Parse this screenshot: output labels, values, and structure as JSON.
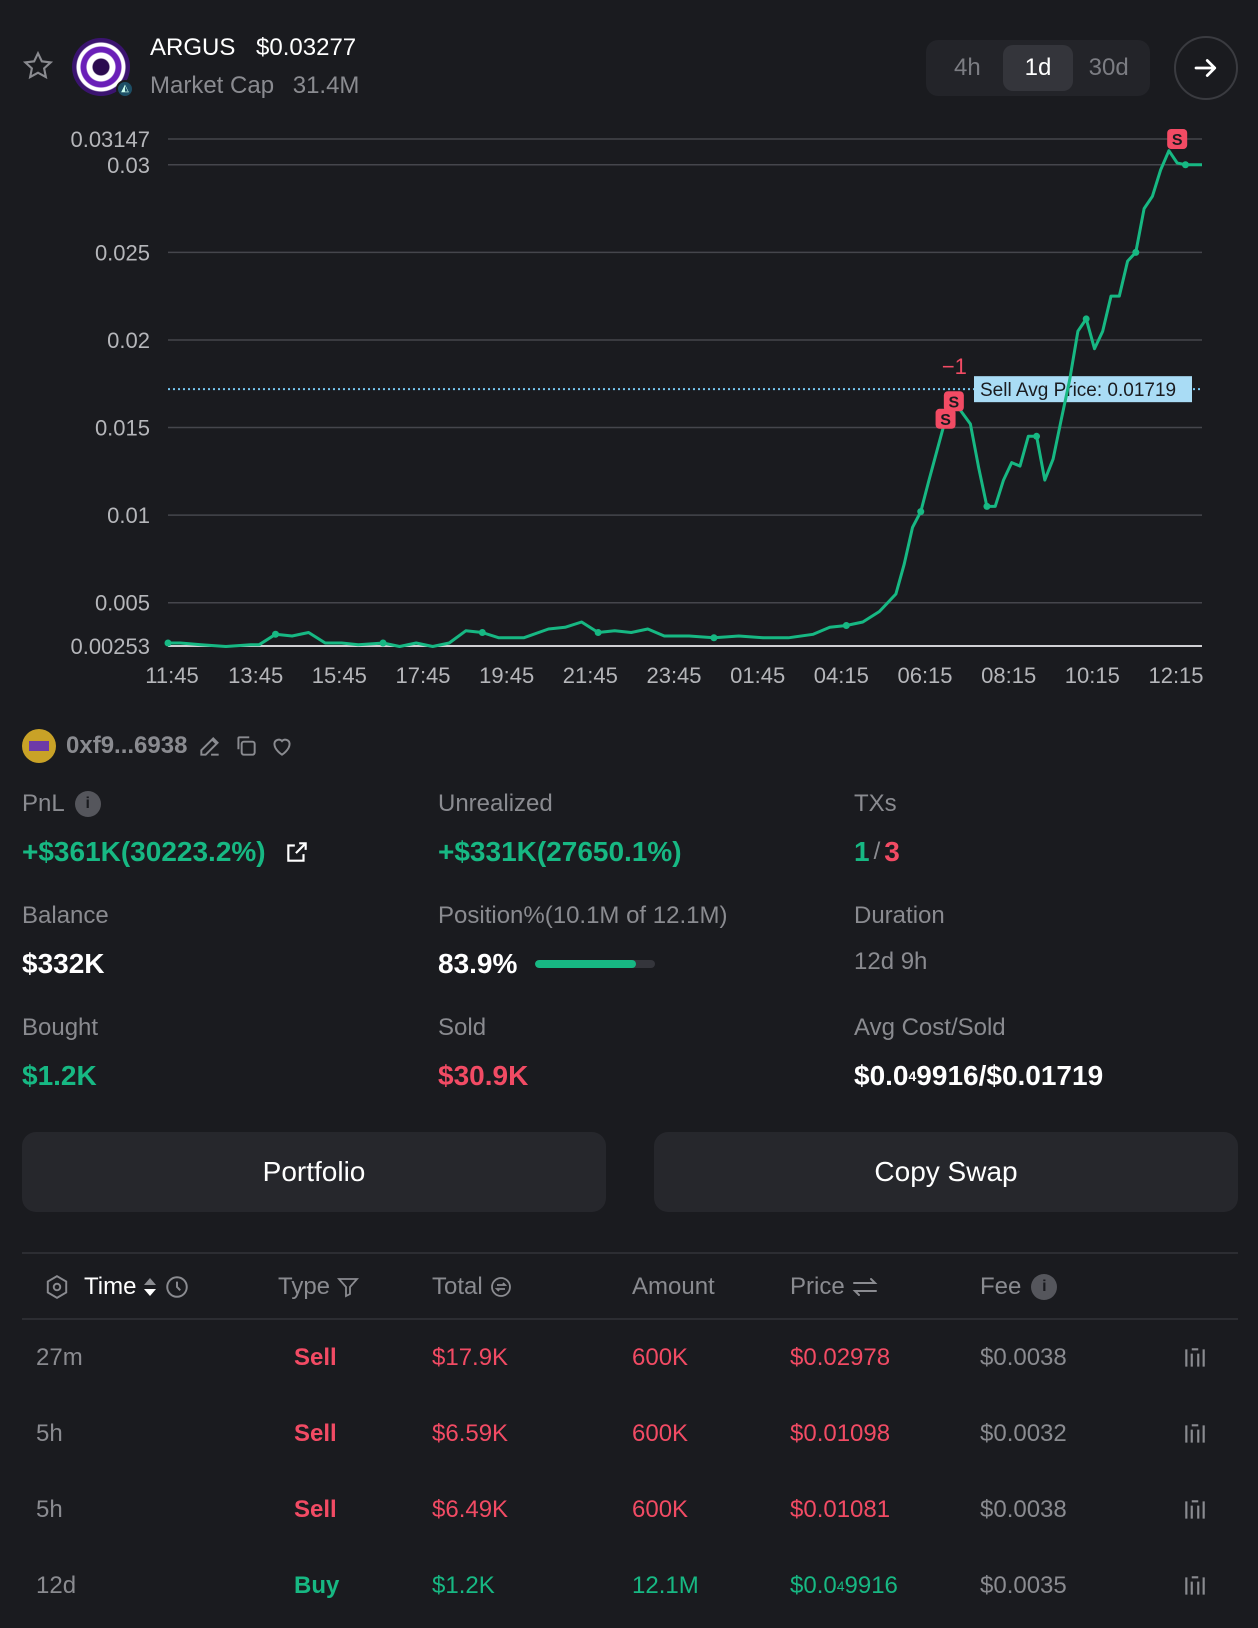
{
  "header": {
    "token_name": "ARGUS",
    "token_price": "$0.03277",
    "market_cap_label": "Market Cap",
    "market_cap_value": "31.4M",
    "timeframes": [
      "4h",
      "1d",
      "30d"
    ],
    "active_timeframe": "1d"
  },
  "chart_data": {
    "type": "line",
    "x_tick_labels": [
      "11:45",
      "13:45",
      "15:45",
      "17:45",
      "19:45",
      "21:45",
      "23:45",
      "01:45",
      "04:15",
      "06:15",
      "08:15",
      "10:15",
      "12:15"
    ],
    "y_tick_labels": [
      "0.03147",
      "0.03",
      "0.025",
      "0.02",
      "0.015",
      "0.01",
      "0.005",
      "0.00253"
    ],
    "y_ticks": [
      0.03147,
      0.03,
      0.025,
      0.02,
      0.015,
      0.01,
      0.005,
      0.00253
    ],
    "ylim": [
      0.00253,
      0.03147
    ],
    "xlim": [
      0,
      12.5
    ],
    "grid": true,
    "line_color": "#17b883",
    "series": [
      {
        "x": [
          0,
          0.15,
          0.4,
          0.7,
          1.0,
          1.1,
          1.3,
          1.5,
          1.7,
          1.9,
          2.1,
          2.3,
          2.6,
          2.8,
          3.0,
          3.2,
          3.4,
          3.6,
          3.8,
          4.0,
          4.3,
          4.6,
          4.8,
          5.0,
          5.2,
          5.4,
          5.6,
          5.8,
          6.0,
          6.3,
          6.6,
          6.9,
          7.2,
          7.5,
          7.8,
          8.0,
          8.2,
          8.4,
          8.6,
          8.8,
          8.9,
          9.0,
          9.1,
          9.2,
          9.4,
          9.5,
          9.7,
          9.8,
          9.9,
          10.0,
          10.1,
          10.2,
          10.3,
          10.4,
          10.5,
          10.6,
          10.7,
          10.8,
          10.9,
          11.0,
          11.1,
          11.2,
          11.3,
          11.4,
          11.5,
          11.6,
          11.7,
          11.8,
          11.9,
          12.0,
          12.1,
          12.2,
          12.3,
          12.4,
          12.5
        ],
        "y": [
          0.0027,
          0.0027,
          0.0026,
          0.0025,
          0.0026,
          0.0026,
          0.0032,
          0.0031,
          0.0033,
          0.0027,
          0.0027,
          0.0026,
          0.0027,
          0.0025,
          0.0027,
          0.0025,
          0.0027,
          0.0034,
          0.0033,
          0.003,
          0.003,
          0.0035,
          0.0036,
          0.0039,
          0.0033,
          0.0034,
          0.0033,
          0.0035,
          0.0031,
          0.0031,
          0.003,
          0.0031,
          0.003,
          0.003,
          0.0032,
          0.0036,
          0.0037,
          0.0039,
          0.0045,
          0.0055,
          0.0072,
          0.0093,
          0.0102,
          0.012,
          0.0155,
          0.0165,
          0.0152,
          0.0127,
          0.0105,
          0.0105,
          0.012,
          0.013,
          0.0128,
          0.0145,
          0.0145,
          0.012,
          0.0132,
          0.0155,
          0.0177,
          0.0205,
          0.0212,
          0.0195,
          0.0205,
          0.0225,
          0.0225,
          0.0245,
          0.025,
          0.0275,
          0.0282,
          0.0297,
          0.0308,
          0.0301,
          0.03,
          0.03,
          0.03
        ]
      }
    ],
    "reference_line": {
      "y": 0.01719,
      "label": "Sell Avg Price: 0.01719",
      "color": "#76c6f0"
    },
    "markers": [
      {
        "x": 9.4,
        "y": 0.0155,
        "label": "S"
      },
      {
        "x": 9.5,
        "y": 0.0165,
        "label": "S"
      },
      {
        "x": 12.2,
        "y": 0.03147,
        "label": "S"
      }
    ],
    "annotation": {
      "x": 9.5,
      "y": 0.0185,
      "label": "−1"
    }
  },
  "wallet": {
    "address": "0xf9...6938"
  },
  "stats": {
    "pnl_label": "PnL",
    "pnl_value": "+$361K(30223.2%)",
    "unrealized_label": "Unrealized",
    "unrealized_value": "+$331K(27650.1%)",
    "txs_label": "TXs",
    "txs_buy": "1",
    "txs_sep": "/",
    "txs_sell": "3",
    "balance_label": "Balance",
    "balance_value": "$332K",
    "position_label": "Position%(10.1M of 12.1M)",
    "position_value": "83.9%",
    "position_fraction": 0.839,
    "duration_label": "Duration",
    "duration_value": "12d 9h",
    "bought_label": "Bought",
    "bought_value": "$1.2K",
    "sold_label": "Sold",
    "sold_value": "$30.9K",
    "avg_label": "Avg Cost/Sold",
    "avg_prefix": "$0.0",
    "avg_sub": "4",
    "avg_suffix": "9916/$0.01719"
  },
  "buttons": {
    "portfolio": "Portfolio",
    "copy_swap": "Copy Swap"
  },
  "table": {
    "headers": {
      "time": "Time",
      "type": "Type",
      "total": "Total",
      "amount": "Amount",
      "price": "Price",
      "fee": "Fee"
    },
    "rows": [
      {
        "time": "27m",
        "type": "Sell",
        "total": "$17.9K",
        "amount": "600K",
        "price": "$0.02978",
        "price_sub": "",
        "price_rest": "",
        "fee": "$0.0038"
      },
      {
        "time": "5h",
        "type": "Sell",
        "total": "$6.59K",
        "amount": "600K",
        "price": "$0.01098",
        "price_sub": "",
        "price_rest": "",
        "fee": "$0.0032"
      },
      {
        "time": "5h",
        "type": "Sell",
        "total": "$6.49K",
        "amount": "600K",
        "price": "$0.01081",
        "price_sub": "",
        "price_rest": "",
        "fee": "$0.0038"
      },
      {
        "time": "12d",
        "type": "Buy",
        "total": "$1.2K",
        "amount": "12.1M",
        "price": "$0.0",
        "price_sub": "4",
        "price_rest": "9916",
        "fee": "$0.0035"
      }
    ]
  }
}
